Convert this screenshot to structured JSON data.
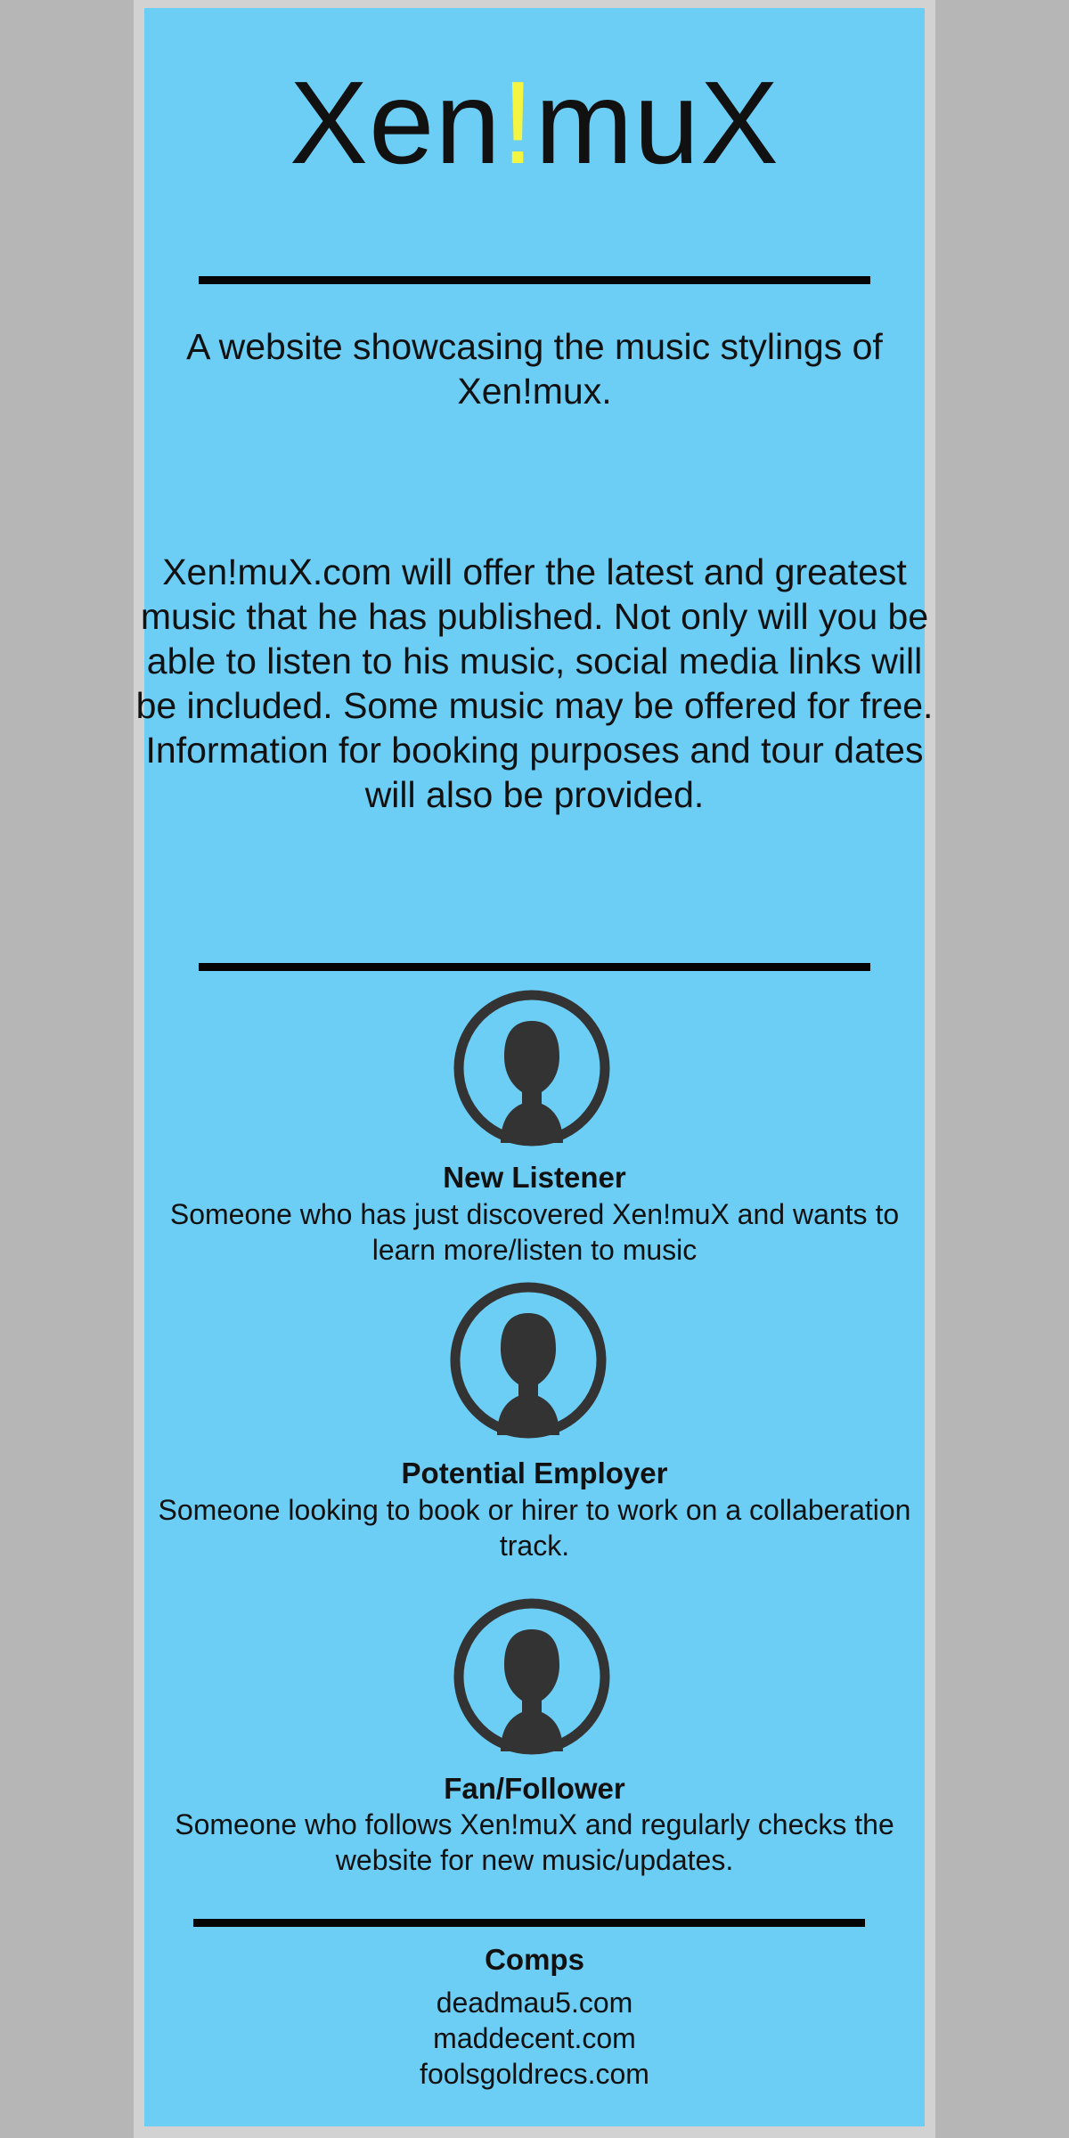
{
  "brand": {
    "logo_before": "Xen",
    "logo_bang": "!",
    "logo_after": "muX",
    "bang_color": "#f3f542"
  },
  "tagline": "A website showcasing the music stylings of Xen!mux.",
  "description": "Xen!muX.com will offer the latest and greatest music that he has published. Not only will you be able to listen to his music, social media links will be included. Some music may be offered for free. Information for booking purposes and tour dates will also be provided.",
  "personas": [
    {
      "icon": "user-avatar-icon",
      "name": "New Listener",
      "description": "Someone who has just discovered Xen!muX and wants to learn more/listen to music"
    },
    {
      "icon": "user-avatar-icon",
      "name": "Potential Employer",
      "description": "Someone looking to book or hirer to work on a collaberation track."
    },
    {
      "icon": "user-avatar-icon",
      "name": "Fan/Follower",
      "description": "Someone who follows Xen!muX and regularly checks the website for new music/updates."
    }
  ],
  "comps": {
    "title": "Comps",
    "sites": [
      "deadmau5.com",
      "maddecent.com",
      "foolsgoldrecs.com"
    ]
  },
  "colors": {
    "page_background": "#b6b6b6",
    "panel_background": "#6ccdf5",
    "rule": "#050505",
    "icon": "#333333"
  }
}
